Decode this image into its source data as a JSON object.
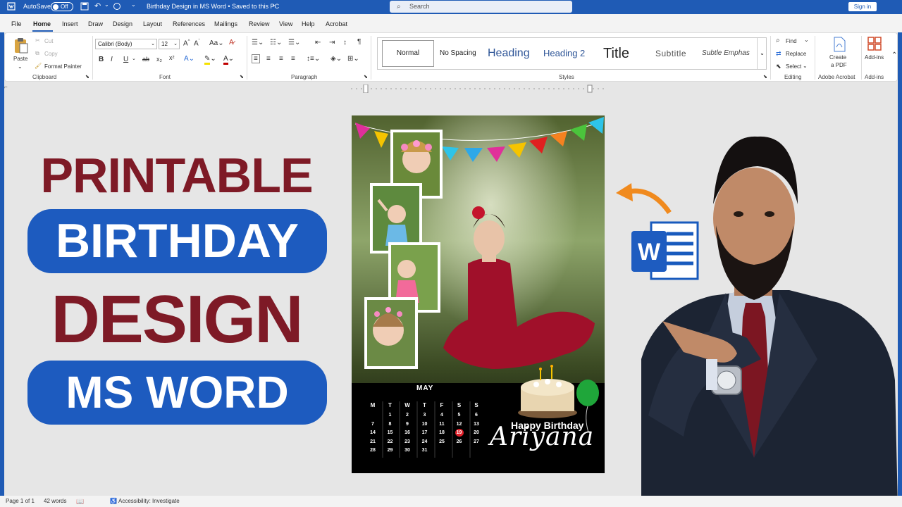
{
  "titlebar": {
    "autosave_label": "AutoSave",
    "autosave_state": "Off",
    "doc_title": "Birthday Design in MS Word • Saved to this PC",
    "search_placeholder": "Search",
    "signin_label": "Sign in"
  },
  "menu": {
    "tabs": [
      "File",
      "Home",
      "Insert",
      "Draw",
      "Design",
      "Layout",
      "References",
      "Mailings",
      "Review",
      "View",
      "Help",
      "Acrobat"
    ],
    "active_tab": "Home"
  },
  "ribbon": {
    "clipboard": {
      "paste": "Paste",
      "cut": "Cut",
      "copy": "Copy",
      "format_painter": "Format Painter",
      "label": "Clipboard"
    },
    "font": {
      "name": "Calibri (Body)",
      "size": "12",
      "label": "Font"
    },
    "paragraph": {
      "label": "Paragraph"
    },
    "styles": {
      "items": [
        "Normal",
        "No Spacing",
        "Heading",
        "Heading 2",
        "Title",
        "Subtitle",
        "Subtle Emphas"
      ],
      "label": "Styles"
    },
    "editing": {
      "find": "Find",
      "replace": "Replace",
      "select": "Select",
      "label": "Editing"
    },
    "acrobat": {
      "create_pdf_line1": "Create",
      "create_pdf_line2": "a PDF",
      "label": "Adobe Acrobat"
    },
    "addins": {
      "button": "Add-ins",
      "label": "Add-ins"
    }
  },
  "thumbnail": {
    "line1": "PRINTABLE",
    "line2": "BIRTHDAY",
    "line3": "DESIGN",
    "line4": "MS WORD",
    "colors": {
      "red": "#7e1a26",
      "blue": "#1d5bbf"
    }
  },
  "card": {
    "month": "MAY",
    "weekdays": [
      "M",
      "T",
      "W",
      "T",
      "F",
      "S",
      "S"
    ],
    "weeks": [
      [
        "",
        "1",
        "2",
        "3",
        "4",
        "5",
        "6"
      ],
      [
        "7",
        "8",
        "9",
        "10",
        "11",
        "12",
        "13"
      ],
      [
        "14",
        "15",
        "16",
        "17",
        "18",
        "19",
        "20"
      ],
      [
        "21",
        "22",
        "23",
        "24",
        "25",
        "26",
        "27"
      ],
      [
        "28",
        "29",
        "30",
        "31",
        "",
        "",
        ""
      ]
    ],
    "highlight_day": "19",
    "greeting": "Happy Birthday",
    "name": "Ariyana"
  },
  "status": {
    "page": "Page 1 of 1",
    "words": "42 words",
    "accessibility": "Accessibility: Investigate"
  }
}
